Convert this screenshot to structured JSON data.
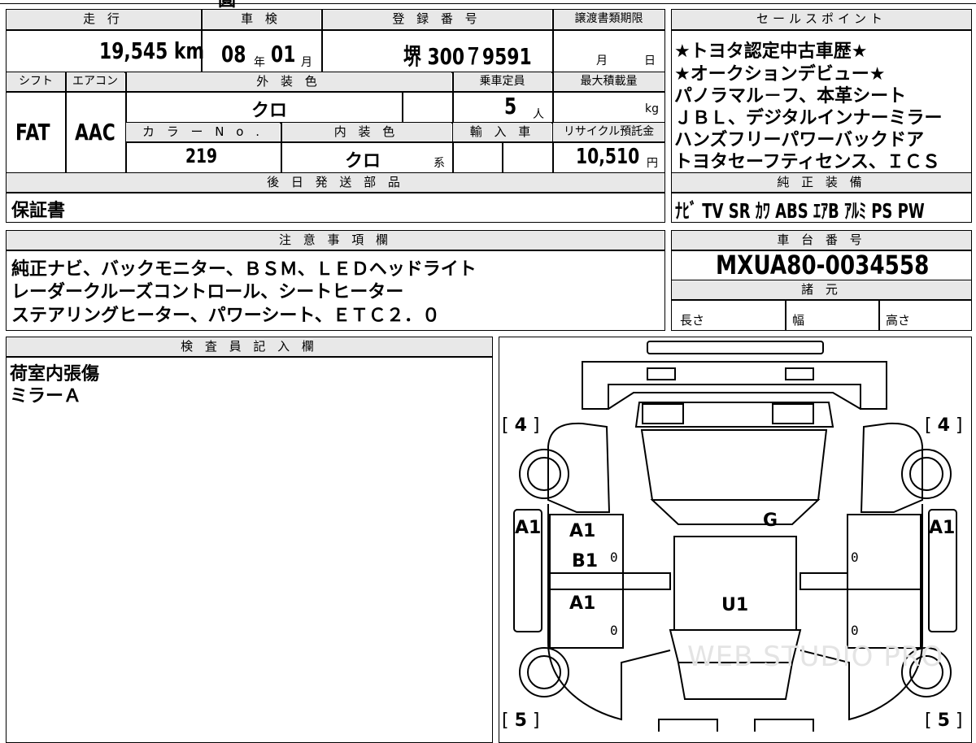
{
  "top_partial": {
    "char": "圓"
  },
  "vehicle": {
    "mileage_label": "走 行",
    "mileage_value": "19,545",
    "mileage_unit": "km",
    "inspection_label": "車 検",
    "inspection_year": "08",
    "inspection_year_unit": "年",
    "inspection_month": "01",
    "inspection_month_unit": "月",
    "registration_label": "登 録 番 号",
    "registration_value": "堺 300７9591",
    "transfer_label": "譲渡書類期限",
    "transfer_month": "月",
    "transfer_day": "日",
    "shift_label": "シフト",
    "shift_value": "FAT",
    "ac_label": "エアコン",
    "ac_value": "AAC",
    "exterior_label": "外 装 色",
    "exterior_value": "クロ",
    "capacity_label": "乗車定員",
    "capacity_value": "5",
    "capacity_unit": "人",
    "max_load_label": "最大積載量",
    "max_load_unit": "kg",
    "color_no_label": "カ ラ ー N o .",
    "color_no_value": "219",
    "interior_label": "内 装 色",
    "interior_value": "クロ",
    "interior_unit": "系",
    "import_label": "輸 入 車",
    "recycle_label": "リサイクル預託金",
    "recycle_value": "10,510",
    "recycle_unit": "円",
    "parts_label": "後 日 発 送 部 品",
    "parts_value": "保証書"
  },
  "sales": {
    "label": "セールスポイント",
    "lines": [
      "★トヨタ認定中古車歴★",
      "★オークションデビュー★",
      "パノラマル－フ、本革シート",
      "ＪＢＬ、デジタルインナーミラー",
      "ハンズフリーパワーバックドア",
      "トヨタセーフティセンス、ＩＣＳ"
    ],
    "equip_label": "純 正 装 備",
    "equip_value": "ﾅﾋﾞ TV SR ｶﾜ ABS ｴｱB ｱﾙﾐ PS PW"
  },
  "notes": {
    "label": "注 意 事 項 欄",
    "lines": [
      "純正ナビ、バックモニター、ＢＳＭ、ＬＥＤヘッドライト",
      "レーダークルーズコントロール、シートヒーター",
      "ステアリングヒーター、パワーシート、ＥＴＣ２．０"
    ]
  },
  "chassis": {
    "label": "車 台 番 号",
    "value": "MXUA80-0034558",
    "spec_label": "諸 元",
    "length_label": "長さ",
    "width_label": "幅",
    "height_label": "高さ"
  },
  "inspector": {
    "label": "検 査 員 記 入 欄",
    "lines": [
      "荷室内張傷",
      "ミラーＡ"
    ]
  },
  "diagram": {
    "front_left_tire": "4",
    "front_right_tire": "4",
    "rear_left_tire": "5",
    "rear_right_tire": "5",
    "left_fender": "A1",
    "right_fender": "A1",
    "left_front_door": "A1",
    "left_front_door_b": "B1",
    "left_rear_door": "A1",
    "windshield": "G",
    "roof": "U1",
    "zeros": [
      "0",
      "0",
      "0",
      "0"
    ],
    "watermark": "WEB STUDIO PRO"
  }
}
